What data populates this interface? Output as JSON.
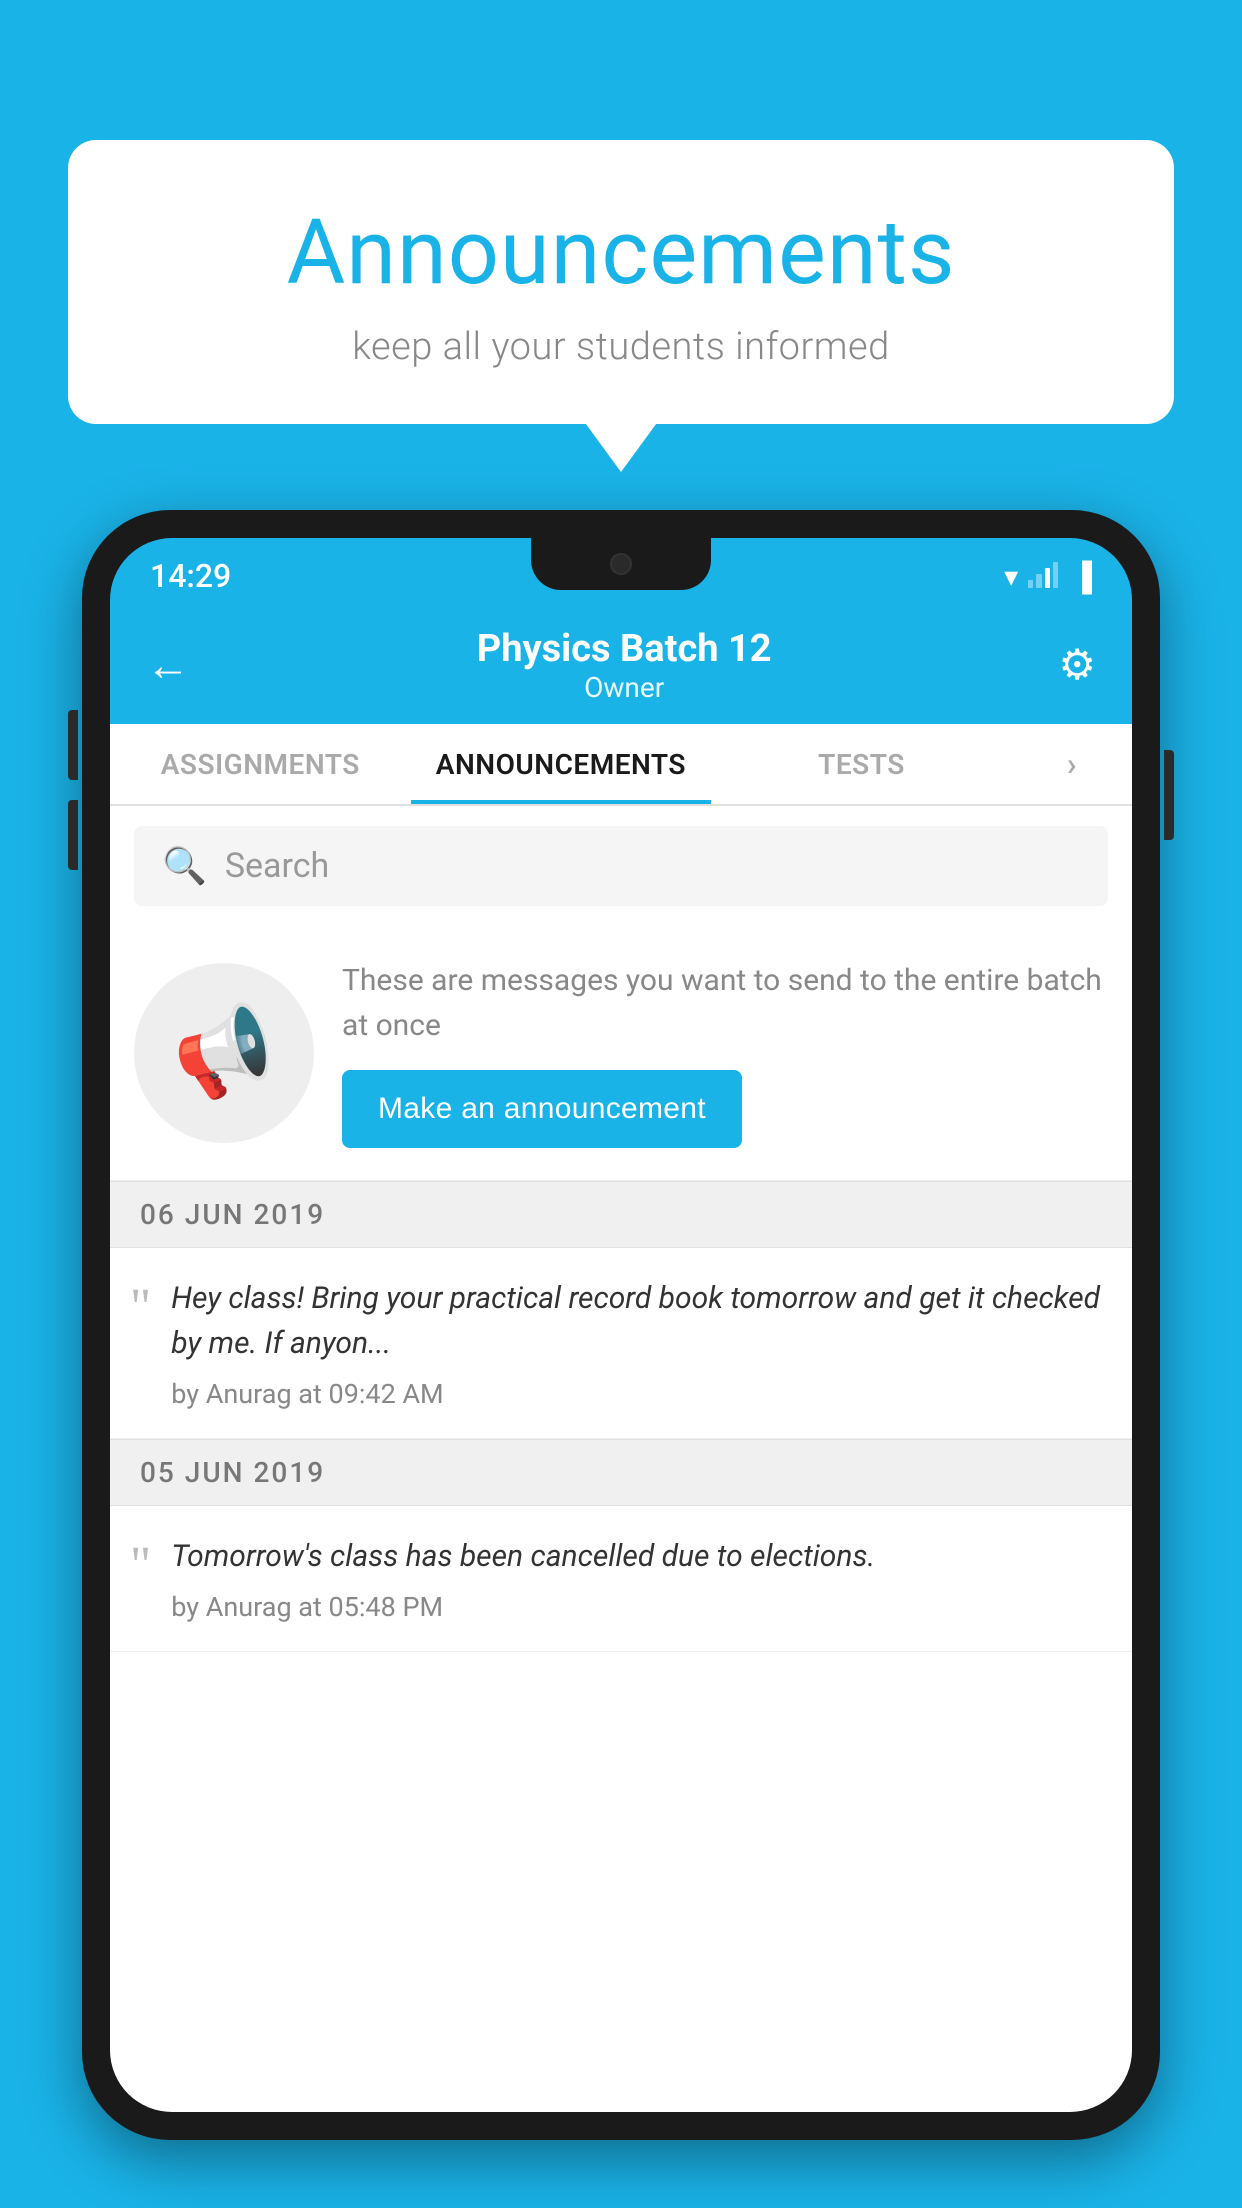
{
  "header": {
    "title": "Announcements",
    "subtitle": "keep all your students informed"
  },
  "phone": {
    "status_time": "14:29",
    "app_bar": {
      "title": "Physics Batch 12",
      "subtitle": "Owner",
      "back_label": "←",
      "settings_label": "⚙"
    },
    "tabs": [
      {
        "label": "ASSIGNMENTS",
        "active": false
      },
      {
        "label": "ANNOUNCEMENTS",
        "active": true
      },
      {
        "label": "TESTS",
        "active": false
      }
    ],
    "search": {
      "placeholder": "Search"
    },
    "promo": {
      "description": "These are messages you want to send to the entire batch at once",
      "button_label": "Make an announcement"
    },
    "announcements": [
      {
        "date": "06  JUN  2019",
        "text": "Hey class! Bring your practical record book tomorrow and get it checked by me. If anyon...",
        "meta": "by Anurag at 09:42 AM"
      },
      {
        "date": "05  JUN  2019",
        "text": "Tomorrow's class has been cancelled due to elections.",
        "meta": "by Anurag at 05:48 PM"
      }
    ]
  }
}
